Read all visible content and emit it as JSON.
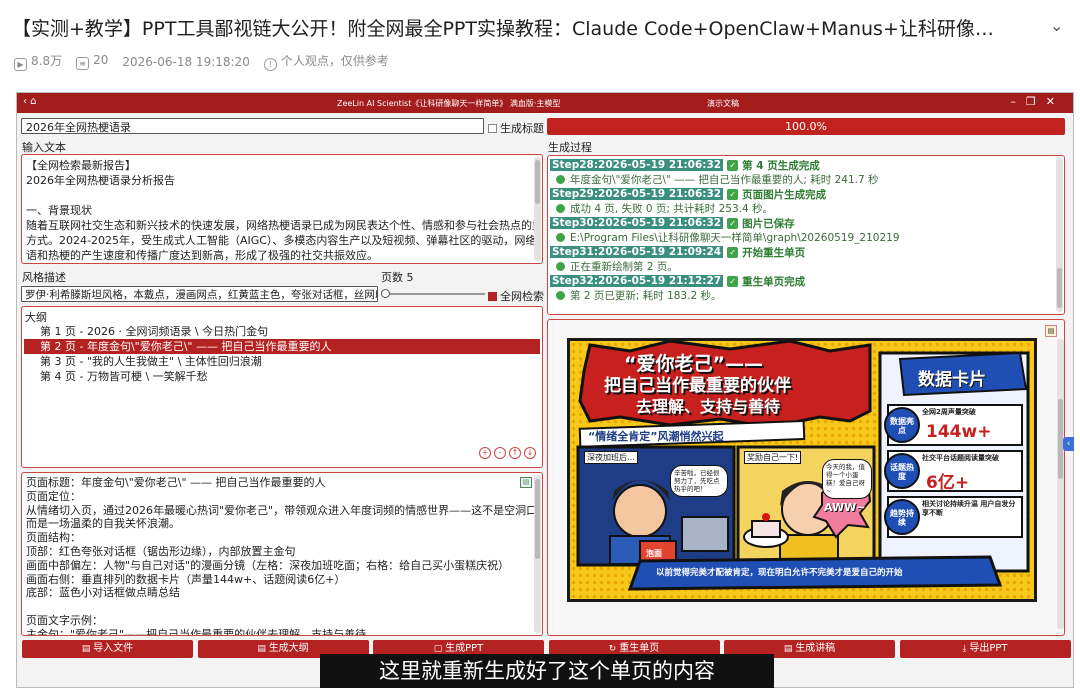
{
  "video": {
    "title": "【实测+教学】PPT工具鄙视链大公开！附全网最全PPT实操教程：Claude Code+OpenClaw+Manus+让科研像…",
    "views": "8.8万",
    "comments": "20",
    "date": "2026-06-18 19:18:20",
    "note": "个人观点，仅供参考",
    "subtitle": "这里就重新生成好了这个单页的内容"
  },
  "app": {
    "title": "ZeeLin AI Scientist《让科研像聊天一样简单》 满血版·主模型",
    "title_right": "演示文稿",
    "topic": "2026年全网热梗语录",
    "gen_title_label": "生成标题",
    "input_label": "输入文本",
    "input_lines": [
      "【全网检索最新报告】",
      "2026年全网热梗语录分析报告",
      "",
      "一、背景现状",
      "随着互联网社交生态和新兴技术的快速发展，网络热梗语录已成为网民表达个性、情感和参与社会热点的重要",
      "方式。2024-2025年，受生成式人工智能（AIGC）、多模态内容生产以及短视频、弹幕社区的驱动，网络流行",
      "语和热梗的产生速度和传播广度达到新高，形成了极强的社交共振效应。"
    ],
    "style_label": "风格描述",
    "style_value": "罗伊·利希滕斯坦风格，本戴点，漫画网点，红黄蓝主色，夸张对话框，丝网印",
    "pages_label": "页数 5",
    "web_search_label": "全网检索",
    "outline_label": "大纲",
    "outline_items": [
      "第 1 页 - 2026 · 全网词频语录 \\ 今日热门金句",
      "第 2 页 - 年度金句\\\"爱你老己\\\" —— 把自己当作最重要的人",
      "第 3 页 - \"我的人生我做主\" \\ 主体性回归浪潮",
      "第 4 页 - 万物皆可梗 \\ 一笑解千愁"
    ],
    "page_detail_lines": [
      "页面标题：年度金句\\\"爱你老己\\\" —— 把自己当作最重要的人",
      "页面定位：",
      "从情绪切入页，通过2026年最暖心热词\"爱你老己\"，带领观众进入年度词频的情感世界——这不是空洞口号，",
      "而是一场温柔的自我关怀浪潮。",
      "页面结构：",
      "顶部：红色夸张对话框（锯齿形边缘），内部放置主金句",
      "画面中部偏左：人物\"与自己对话\"的漫画分镜（左格：深夜加班吃面；右格：给自己买小蛋糕庆祝）",
      "画面右侧：垂直排列的数据卡片（声量144w+、话题阅读6亿+）",
      "底部：蓝色小对话框做点睛总结",
      "",
      "页面文字示例：",
      "主金句：\"爱你老己\"——把自己当作最重要的伙伴去理解，支持与善待"
    ],
    "progress": "100.0%",
    "process_label": "生成过程",
    "steps": [
      {
        "kind": "step",
        "badge": "Step28:2026-05-19 21:06:32",
        "text": "第 4 页生成完成"
      },
      {
        "kind": "sub",
        "text": "年度金句\\\"爱你老己\\\" —— 把自己当作最重要的人; 耗时 241.7 秒"
      },
      {
        "kind": "step",
        "badge": "Step29:2026-05-19 21:06:32",
        "text": "页面图片生成完成"
      },
      {
        "kind": "sub",
        "text": "成功 4 页, 失败 0 页; 共计耗时 253.4 秒。"
      },
      {
        "kind": "step",
        "badge": "Step30:2026-05-19 21:06:32",
        "text": "图片已保存"
      },
      {
        "kind": "sub",
        "text": "E:\\Program Files\\让科研像聊天一样简单\\graph\\20260519_210219"
      },
      {
        "kind": "step",
        "badge": "Step31:2026-05-19 21:09:24",
        "text": "开始重生单页"
      },
      {
        "kind": "sub",
        "text": "正在重新绘制第 2 页。"
      },
      {
        "kind": "step",
        "badge": "Step32:2026-05-19 21:12:27",
        "text": "重生单页完成"
      },
      {
        "kind": "sub",
        "text": "第 2 页已更新; 耗时 183.2 秒。"
      }
    ],
    "buttons": [
      "导入文件",
      "生成大纲",
      "生成PPT",
      "重生单页",
      "生成讲稿",
      "导出PPT"
    ]
  },
  "slide": {
    "headline_1": "“爱你老己”——",
    "headline_2": "把自己当作最重要的伙伴",
    "headline_3": "去理解、支持与善待",
    "ribbon": "“情绪全肯定”风潮悄然兴起",
    "panel_left_caption": "深夜加班后…",
    "panel_left_bubble": "辛苦啦，已经很努力了，先吃点热乎的吧！",
    "panel_left_bowl": "泡面",
    "panel_right_caption": "奖励自己一下!",
    "panel_right_bubble": "今天的我，值得一个小蛋糕！爱自己呀~",
    "panel_right_sfx": "AWW~",
    "card_title": "数据卡片",
    "cards": [
      {
        "tag": "数据亮点",
        "label": "全网2周声量突破",
        "value": "144w+"
      },
      {
        "tag": "话题热度",
        "label": "社交平台话题阅读量突破",
        "value": "6亿+"
      },
      {
        "tag": "趋势持续",
        "label": "相关讨论持续升温 用户自发分享不断",
        "value": ""
      }
    ],
    "footer": "以前觉得完美才配被肯定，现在明白允许不完美才是爱自己的开始"
  }
}
